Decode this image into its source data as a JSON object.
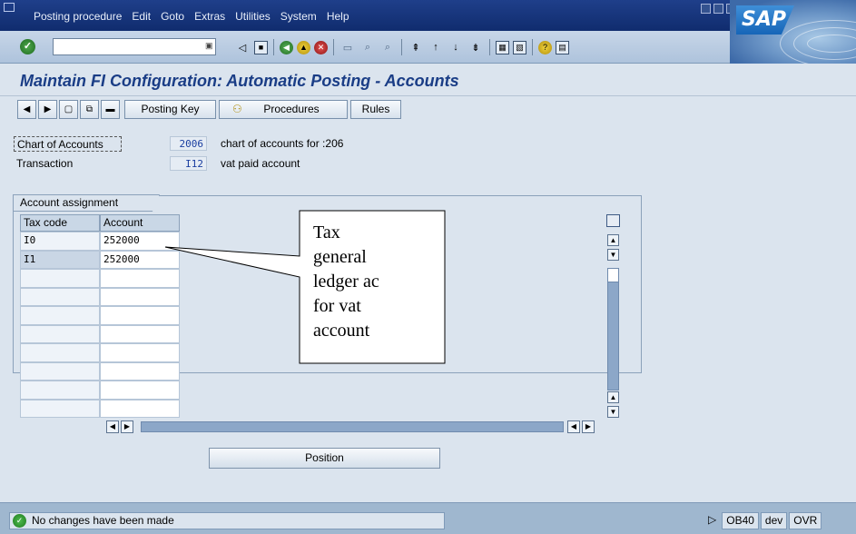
{
  "menubar": {
    "items": [
      {
        "label": "Posting procedure",
        "name": "menu-posting-procedure"
      },
      {
        "label": "Edit",
        "name": "menu-edit"
      },
      {
        "label": "Goto",
        "name": "menu-goto"
      },
      {
        "label": "Extras",
        "name": "menu-extras"
      },
      {
        "label": "Utilities",
        "name": "menu-utilities"
      },
      {
        "label": "System",
        "name": "menu-system"
      },
      {
        "label": "Help",
        "name": "menu-help"
      }
    ],
    "logo_text": "SAP"
  },
  "std_toolbar": {
    "okcode_value": ""
  },
  "page": {
    "title": "Maintain FI Configuration: Automatic Posting - Accounts"
  },
  "app_toolbar": {
    "posting_key_label": "Posting Key",
    "procedures_label": "Procedures",
    "rules_label": "Rules"
  },
  "header_fields": {
    "chart_label": "Chart of Accounts",
    "chart_value": "2006",
    "chart_desc": "chart of accounts for :206",
    "transaction_label": "Transaction",
    "transaction_value": "I12",
    "transaction_desc": "vat paid account"
  },
  "assignment": {
    "group_title": "Account assignment",
    "columns": [
      "Tax code",
      "Account"
    ],
    "rows": [
      {
        "tax_code": "I0",
        "account": "252000"
      },
      {
        "tax_code": "I1",
        "account": "252000"
      },
      {
        "tax_code": "",
        "account": ""
      },
      {
        "tax_code": "",
        "account": ""
      },
      {
        "tax_code": "",
        "account": ""
      },
      {
        "tax_code": "",
        "account": ""
      },
      {
        "tax_code": "",
        "account": ""
      },
      {
        "tax_code": "",
        "account": ""
      },
      {
        "tax_code": "",
        "account": ""
      },
      {
        "tax_code": "",
        "account": ""
      }
    ],
    "position_label": "Position"
  },
  "callout": {
    "lines": [
      "Tax",
      "general",
      "ledger ac",
      "for vat",
      "account"
    ]
  },
  "statusbar": {
    "message": "No changes have been made",
    "tcode": "OB40",
    "system": "dev",
    "mode": "OVR"
  }
}
